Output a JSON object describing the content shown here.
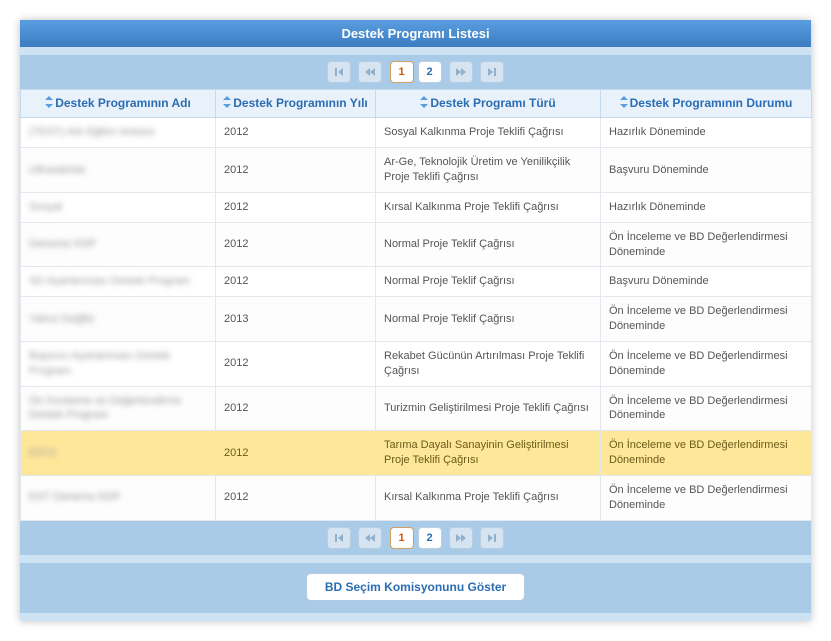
{
  "title": "Destek Programı Listesi",
  "pager": {
    "first": "⏮",
    "prev": "◀◀",
    "next": "▶▶",
    "last": "⏭",
    "pages": [
      "1",
      "2"
    ],
    "active": "1"
  },
  "columns": [
    "Destek Programının Adı",
    "Destek Programının Yılı",
    "Destek Programı Türü",
    "Destek Programının Durumu"
  ],
  "rows": [
    {
      "name": "(TEST) Adı Eğitim Ankara",
      "year": "2012",
      "type": "Sosyal Kalkınma Proje Teklifi Çağrısı",
      "status": "Hazırlık Döneminde",
      "highlight": false
    },
    {
      "name": "Ultrasatırlar",
      "year": "2012",
      "type": "Ar-Ge, Teknolojik Üretim ve Yenilikçilik Proje Teklifi Çağrısı",
      "status": "Başvuru Döneminde",
      "highlight": false
    },
    {
      "name": "Sosyal",
      "year": "2012",
      "type": "Kırsal Kalkınma Proje Teklifi Çağrısı",
      "status": "Hazırlık Döneminde",
      "highlight": false
    },
    {
      "name": "Deneme KDP",
      "year": "2012",
      "type": "Normal Proje Teklif Çağrısı",
      "status": "Ön İnceleme ve BD Değerlendirmesi Döneminde",
      "highlight": false
    },
    {
      "name": "SD Ayarlanması Destek Program",
      "year": "2012",
      "type": "Normal Proje Teklif Çağrısı",
      "status": "Başvuru Döneminde",
      "highlight": false
    },
    {
      "name": "Yalnız Değiliz",
      "year": "2013",
      "type": "Normal Proje Teklif Çağrısı",
      "status": "Ön İnceleme ve BD Değerlendirmesi Döneminde",
      "highlight": false
    },
    {
      "name": "Başvuru Ayarlanması Destek Program",
      "year": "2012",
      "type": "Rekabet Gücünün Artırılması Proje Teklifi Çağrısı",
      "status": "Ön İnceleme ve BD Değerlendirmesi Döneminde",
      "highlight": false
    },
    {
      "name": "Ön İnceleme ve Değerlendirme Destek Program",
      "year": "2012",
      "type": "Turizmin Geliştirilmesi Proje Teklifi Çağrısı",
      "status": "Ön İnceleme ve BD Değerlendirmesi Döneminde",
      "highlight": false
    },
    {
      "name": "EST2",
      "year": "2012",
      "type": "Tarıma Dayalı Sanayinin Geliştirilmesi Proje Teklifi Çağrısı",
      "status": "Ön İnceleme ve BD Değerlendirmesi Döneminde",
      "highlight": true
    },
    {
      "name": "EST Deneme KDP",
      "year": "2012",
      "type": "Kırsal Kalkınma Proje Teklifi Çağrısı",
      "status": "Ön İnceleme ve BD Değerlendirmesi Döneminde",
      "highlight": false
    }
  ],
  "actionLabel": "BD Seçim Komisyonunu Göster"
}
